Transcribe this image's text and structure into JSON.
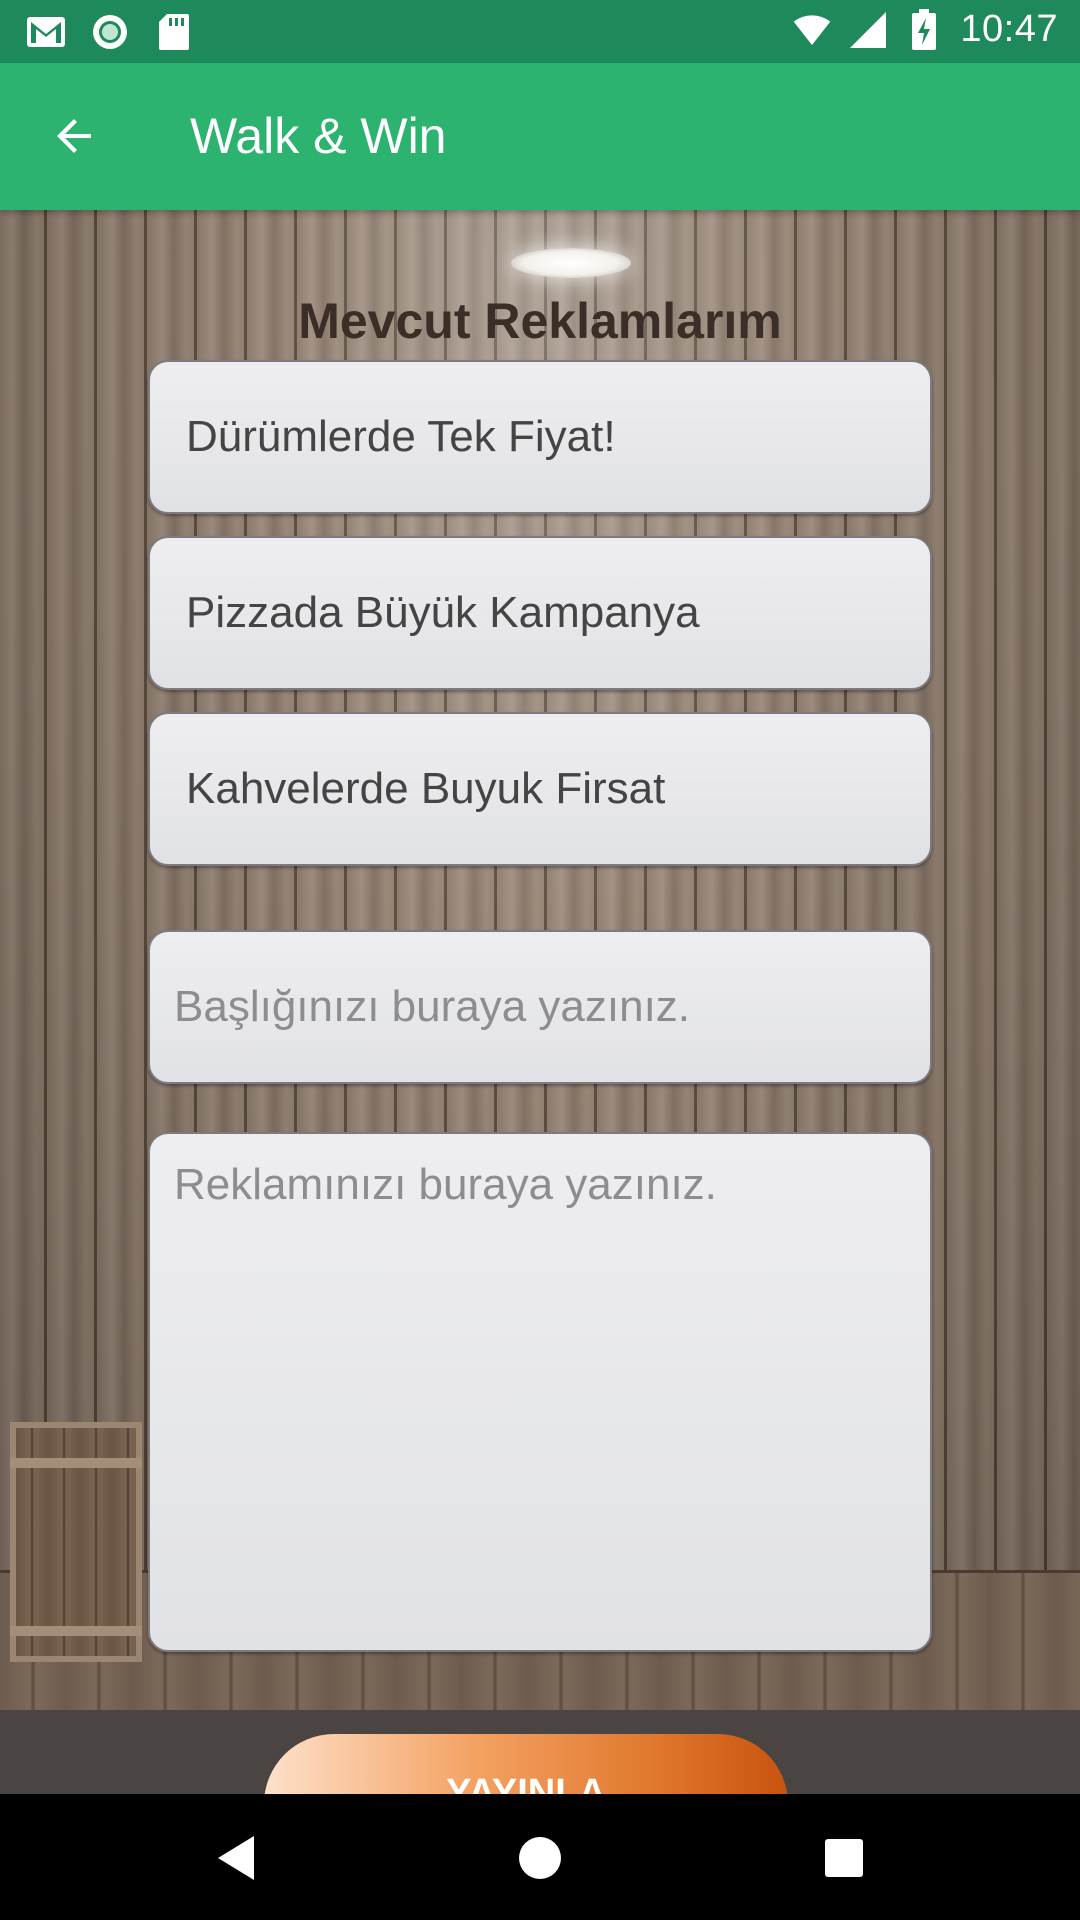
{
  "status_bar": {
    "time": "10:47",
    "icons": [
      "gmail-icon",
      "circle-app-icon",
      "sd-card-icon",
      "wifi-icon",
      "signal-icon",
      "battery-charging-icon"
    ]
  },
  "app_bar": {
    "title": "Walk & Win",
    "back_icon": "arrow-back-icon"
  },
  "main": {
    "section_title": "Mevcut Reklamlarım",
    "ads": [
      {
        "label": "Dürümlerde Tek Fiyat!"
      },
      {
        "label": "Pizzada Büyük Kampanya"
      },
      {
        "label": "Kahvelerde Buyuk Firsat"
      }
    ],
    "title_input": {
      "placeholder": "Başlığınızı buraya yazınız.",
      "value": ""
    },
    "body_input": {
      "placeholder": "Reklamınızı buraya yazınız.",
      "value": ""
    }
  },
  "publish_button": {
    "label": "YAYINLA"
  },
  "nav_bar": {
    "icons": [
      "back-triangle-icon",
      "home-circle-icon",
      "recents-square-icon"
    ]
  },
  "colors": {
    "status_bar": "#1e8a5b",
    "app_bar": "#2db370",
    "accent_orange": "#e0772c"
  }
}
